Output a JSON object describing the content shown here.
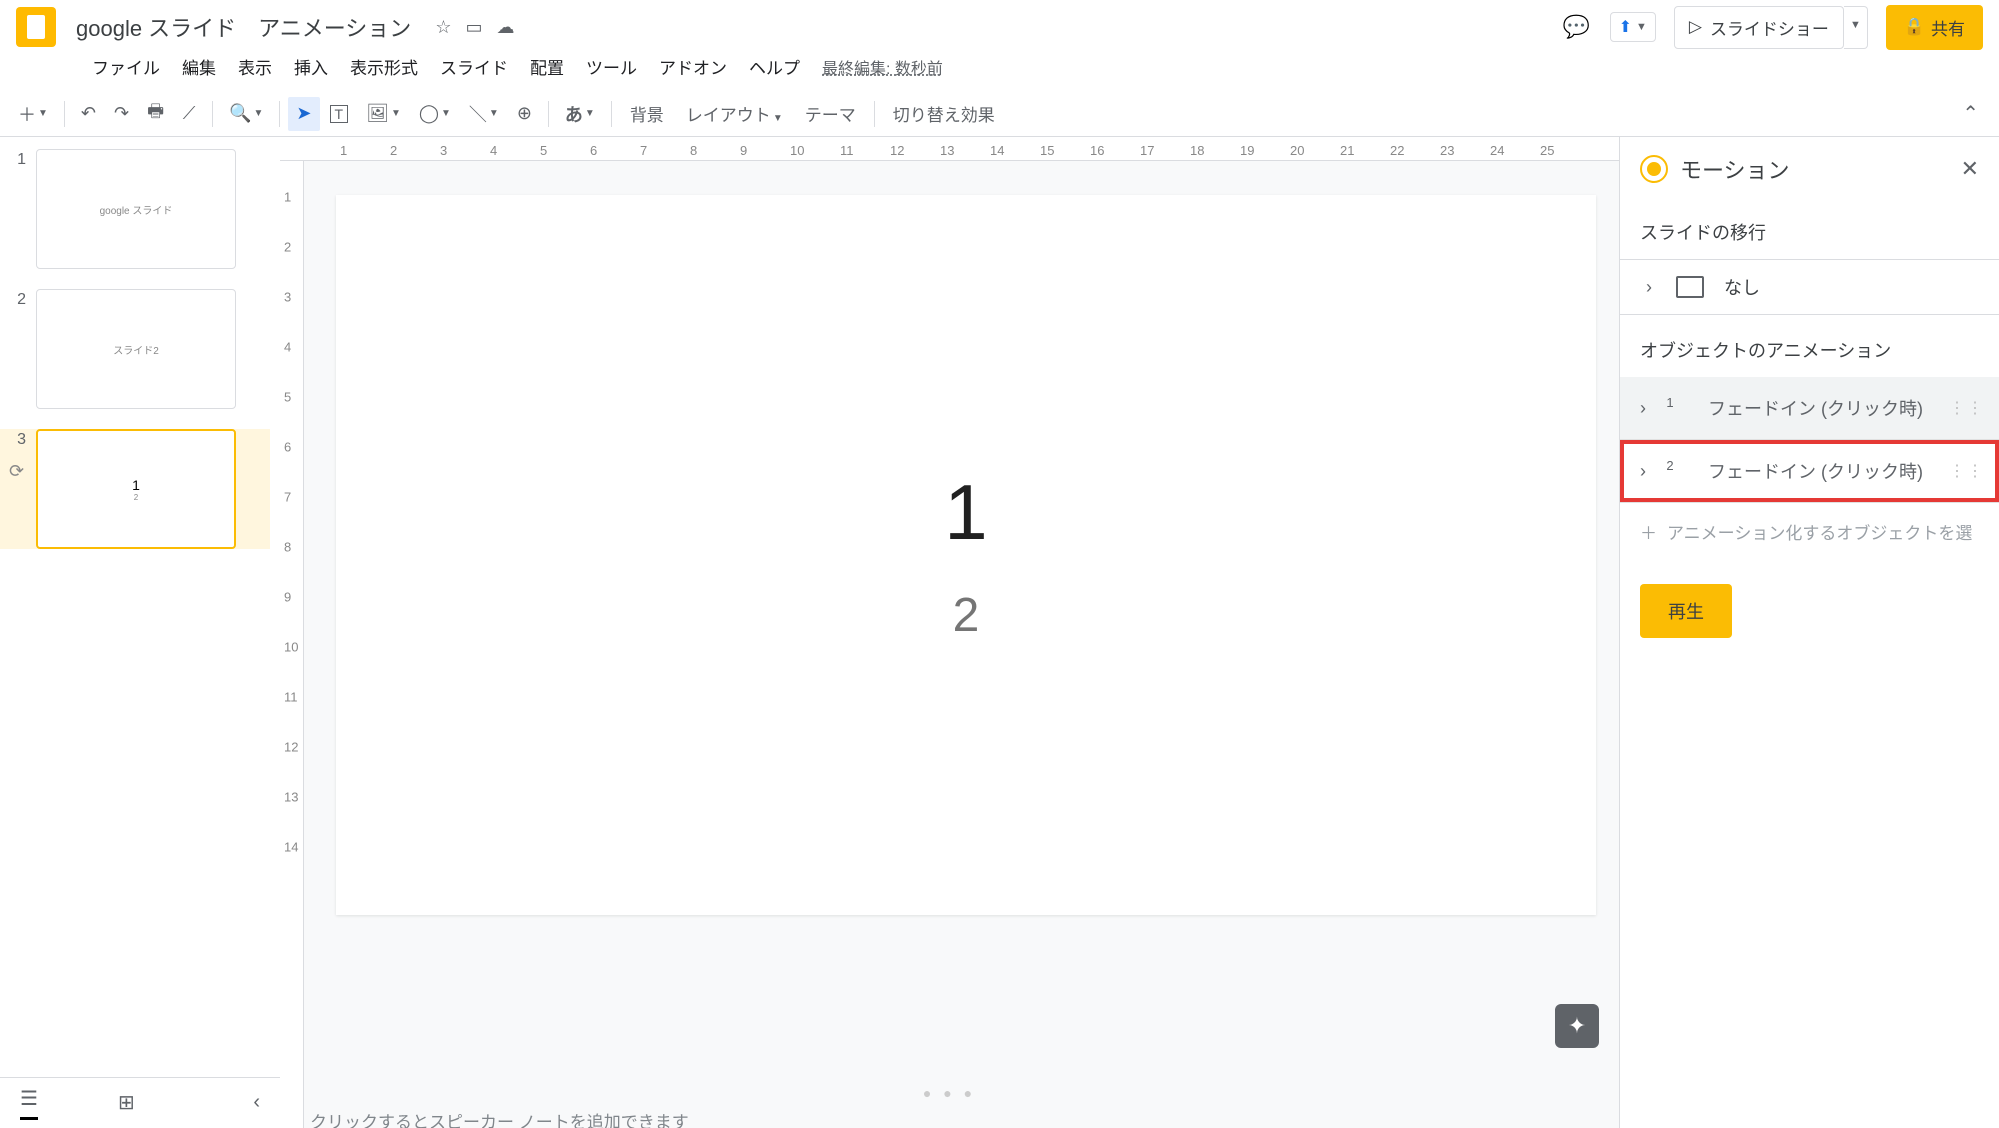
{
  "header": {
    "doc_title": "google スライド　アニメーション",
    "star_icon": "☆",
    "move_icon": "▭",
    "cloud_icon": "☁",
    "comment_icon": "💬",
    "present_up_icon": "⬆",
    "slideshow_icon": "▷",
    "slideshow_label": "スライドショー",
    "share_lock_icon": "🔒",
    "share_label": "共有"
  },
  "menu": {
    "items": [
      "ファイル",
      "編集",
      "表示",
      "挿入",
      "表示形式",
      "スライド",
      "配置",
      "ツール",
      "アドオン",
      "ヘルプ"
    ],
    "last_edit": "最終編集: 数秒前"
  },
  "toolbar": {
    "new_slide": "＋",
    "undo": "↶",
    "redo": "↷",
    "print": "🖶",
    "paint": "⟋",
    "zoom": "🔍",
    "select": "➤",
    "textbox": "T",
    "image": "🖼",
    "shape": "◯",
    "line": "＼",
    "comment": "⊕",
    "ime": "あ",
    "background": "背景",
    "layout": "レイアウト",
    "theme": "テーマ",
    "transition": "切り替え効果",
    "collapse": "⌃"
  },
  "filmstrip": {
    "thumbs": [
      {
        "num": "1",
        "preview_title": "google スライド",
        "preview_sub": ""
      },
      {
        "num": "2",
        "preview_title": "スライド2",
        "preview_sub": ""
      },
      {
        "num": "3",
        "preview_title": "1",
        "preview_sub": "2"
      }
    ],
    "selected_index": 2,
    "anim_indicator": "⟳"
  },
  "canvas": {
    "ruler_h": [
      "1",
      "2",
      "3",
      "4",
      "5",
      "6",
      "7",
      "8",
      "9",
      "10",
      "11",
      "12",
      "13",
      "14",
      "15",
      "16",
      "17",
      "18",
      "19",
      "20",
      "21",
      "22",
      "23",
      "24",
      "25"
    ],
    "ruler_v": [
      "1",
      "2",
      "3",
      "4",
      "5",
      "6",
      "7",
      "8",
      "9",
      "10",
      "11",
      "12",
      "13",
      "14"
    ],
    "slide_title": "1",
    "slide_sub": "2",
    "speaker_placeholder": "クリックするとスピーカー ノートを追加できます",
    "explore": "✦"
  },
  "motion": {
    "title": "モーション",
    "close": "✕",
    "section_transition": "スライドの移行",
    "transition_none": "なし",
    "section_object": "オブジェクトのアニメーション",
    "animations": [
      {
        "num": "1",
        "label": "フェードイン (クリック時)",
        "highlighted": false
      },
      {
        "num": "2",
        "label": "フェードイン (クリック時)",
        "highlighted": true
      }
    ],
    "add_label": "アニメーション化するオブジェクトを選",
    "add_plus": "＋",
    "play": "再生",
    "chevron": "›",
    "drag": "⋮⋮"
  },
  "bottom": {
    "filmstrip_view": "☰",
    "grid_view": "⊞",
    "collapse": "‹"
  }
}
